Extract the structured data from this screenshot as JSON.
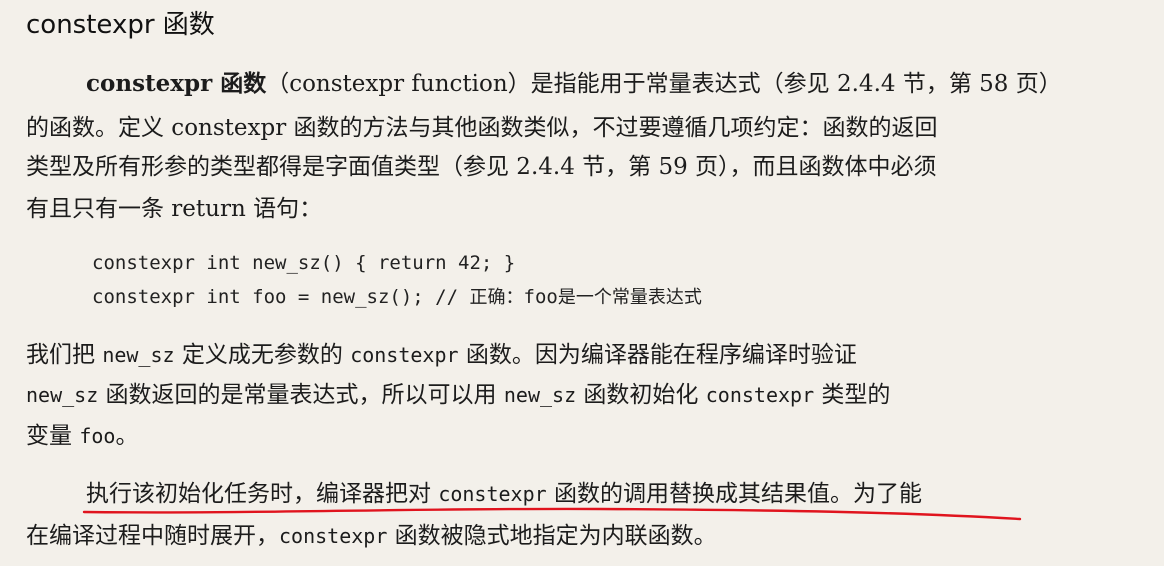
{
  "heading": "constexpr 函数",
  "para1": {
    "line1_term": "constexpr 函数",
    "line1_rest": "（constexpr function）是指能用于常量表达式（参见 2.4.4 节，第 58 页）",
    "line2": "的函数。定义 constexpr 函数的方法与其他函数类似，不过要遵循几项约定：函数的返回",
    "line3": "类型及所有形参的类型都得是字面值类型（参见 2.4.4 节，第 59 页），而且函数体中必须",
    "line4": "有且只有一条 return 语句："
  },
  "code": {
    "line1": "constexpr int new_sz() { return 42; }",
    "line2_code": "constexpr int foo = new_sz(); // ",
    "line2_comment": "正确：",
    "line2_comment_code": "foo",
    "line2_comment_end": "是一个常量表达式"
  },
  "para2": {
    "l1_a": "我们把 ",
    "l1_b": "new_sz",
    "l1_c": " 定义成无参数的 ",
    "l1_d": "constexpr",
    "l1_e": " 函数。因为编译器能在程序编译时验证",
    "l2_a": "new_sz",
    "l2_b": " 函数返回的是常量表达式，所以可以用 ",
    "l2_c": "new_sz",
    "l2_d": " 函数初始化 ",
    "l2_e": "constexpr",
    "l2_f": " 类型的",
    "l3_a": "变量 ",
    "l3_b": "foo",
    "l3_c": "。"
  },
  "para3": {
    "l1_a": "执行该初始化任务时，编译器把对 ",
    "l1_b": "constexpr",
    "l1_c": " 函数的调用替换成其结果值。为了能",
    "l2_a": "在编译过程中随时展开，",
    "l2_b": "constexpr",
    "l2_c": " 函数被隐式地指定为内联函数。"
  },
  "colors": {
    "background": "#f3f0ea",
    "text": "#1c1c1c",
    "annotation_underline": "#e0141e"
  }
}
